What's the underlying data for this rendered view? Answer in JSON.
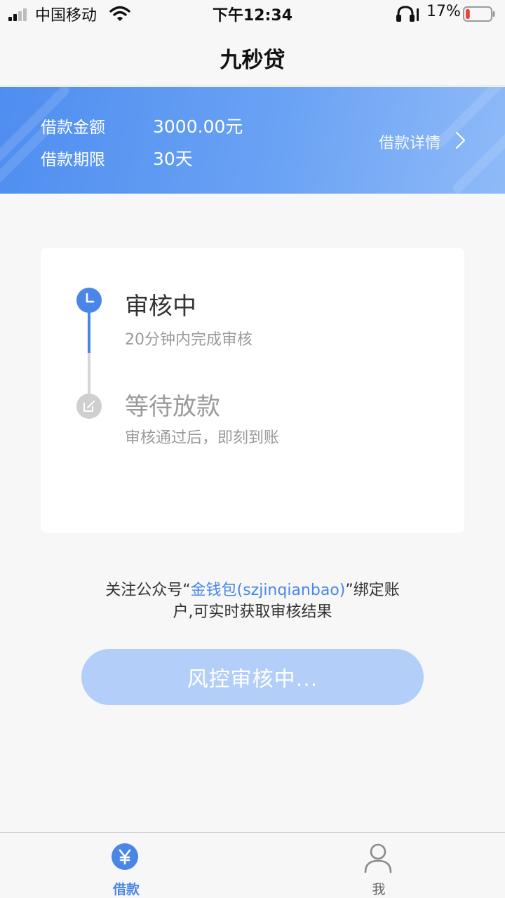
{
  "status_bar": {
    "carrier": "中国移动",
    "time": "下午12:34",
    "battery_percent": "17%",
    "battery_level": 0.17,
    "icons": [
      "signal-icon",
      "wifi-icon",
      "headphones-icon",
      "battery-icon"
    ]
  },
  "nav": {
    "title": "九秒贷"
  },
  "loan": {
    "amount_label": "借款金额",
    "amount_value": "3000.00元",
    "term_label": "借款期限",
    "term_value": "30天",
    "detail_link": "借款详情"
  },
  "progress": {
    "steps": [
      {
        "title": "审核中",
        "subtitle": "20分钟内完成审核",
        "state": "active",
        "icon": "clock-icon"
      },
      {
        "title": "等待放款",
        "subtitle": "审核通过后，即刻到账",
        "state": "pending",
        "icon": "edit-icon"
      }
    ]
  },
  "notice": {
    "prefix": "关注公众号“",
    "link": "金钱包(szjinqianbao)",
    "suffix": "”绑定账户,可实时获取审核结果"
  },
  "action": {
    "button_label": "风控审核中..."
  },
  "tabs": [
    {
      "label": "借款",
      "icon": "yuan-icon",
      "active": true
    },
    {
      "label": "我",
      "icon": "person-icon",
      "active": false
    }
  ],
  "colors": {
    "accent": "#4a86e8",
    "banner_start": "#4f8ef0",
    "banner_end": "#8fbaf8",
    "button_disabled": "#b3cff9",
    "battery_low": "#e8443a"
  }
}
